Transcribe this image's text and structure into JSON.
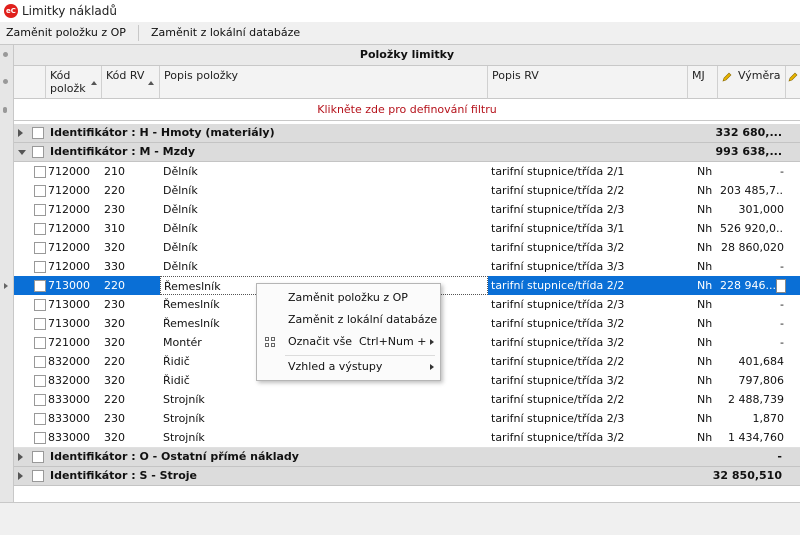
{
  "window": {
    "title": "Limitky nákladů",
    "app_icon_text": "eC"
  },
  "toolbar": {
    "replace_op": "Zaměnit položku z OP",
    "replace_local": "Zaměnit z lokální databáze"
  },
  "grid": {
    "band_title": "Položky limitky",
    "columns": {
      "kod_polozky": "Kód\npoložk",
      "kod_rv": "Kód RV",
      "popis_polozky": "Popis položky",
      "popis_rv": "Popis RV",
      "mj": "MJ",
      "vymera": "Výměra"
    },
    "filter_text": "Klikněte zde pro definování filtru",
    "groups": [
      {
        "label": "Identifikátor : H - Hmoty (materiály)",
        "value": "332 680,..."
      },
      {
        "label": "Identifikátor : M - Mzdy",
        "value": "993 638,..."
      },
      {
        "label": "Identifikátor : O - Ostatní přímé náklady",
        "value": "-"
      },
      {
        "label": "Identifikátor : S - Stroje",
        "value": "32 850,510"
      }
    ],
    "rows": [
      {
        "kod": "712000",
        "rv": "210",
        "popis": "Dělník",
        "popis_rv": "tarifní stupnice/třída 2/1",
        "mj": "Nh",
        "vymera": "-"
      },
      {
        "kod": "712000",
        "rv": "220",
        "popis": "Dělník",
        "popis_rv": "tarifní stupnice/třída 2/2",
        "mj": "Nh",
        "vymera": "203 485,7..."
      },
      {
        "kod": "712000",
        "rv": "230",
        "popis": "Dělník",
        "popis_rv": "tarifní stupnice/třída 2/3",
        "mj": "Nh",
        "vymera": "301,000"
      },
      {
        "kod": "712000",
        "rv": "310",
        "popis": "Dělník",
        "popis_rv": "tarifní stupnice/třída 3/1",
        "mj": "Nh",
        "vymera": "526 920,0..."
      },
      {
        "kod": "712000",
        "rv": "320",
        "popis": "Dělník",
        "popis_rv": "tarifní stupnice/třída 3/2",
        "mj": "Nh",
        "vymera": "28 860,020"
      },
      {
        "kod": "712000",
        "rv": "330",
        "popis": "Dělník",
        "popis_rv": "tarifní stupnice/třída 3/3",
        "mj": "Nh",
        "vymera": "-"
      },
      {
        "kod": "713000",
        "rv": "220",
        "popis": "Řemeslník",
        "popis_rv": "tarifní stupnice/třída 2/2",
        "mj": "Nh",
        "vymera": "228 946...."
      },
      {
        "kod": "713000",
        "rv": "230",
        "popis": "Řemeslník",
        "popis_rv": "tarifní stupnice/třída 2/3",
        "mj": "Nh",
        "vymera": "-"
      },
      {
        "kod": "713000",
        "rv": "320",
        "popis": "Řemeslník",
        "popis_rv": "tarifní stupnice/třída 3/2",
        "mj": "Nh",
        "vymera": "-"
      },
      {
        "kod": "721000",
        "rv": "320",
        "popis": "Montér",
        "popis_rv": "tarifní stupnice/třída 3/2",
        "mj": "Nh",
        "vymera": "-"
      },
      {
        "kod": "832000",
        "rv": "220",
        "popis": "Řidič",
        "popis_rv": "tarifní stupnice/třída 2/2",
        "mj": "Nh",
        "vymera": "401,684"
      },
      {
        "kod": "832000",
        "rv": "320",
        "popis": "Řidič",
        "popis_rv": "tarifní stupnice/třída 3/2",
        "mj": "Nh",
        "vymera": "797,806"
      },
      {
        "kod": "833000",
        "rv": "220",
        "popis": "Strojník",
        "popis_rv": "tarifní stupnice/třída 2/2",
        "mj": "Nh",
        "vymera": "2 488,739"
      },
      {
        "kod": "833000",
        "rv": "230",
        "popis": "Strojník",
        "popis_rv": "tarifní stupnice/třída 2/3",
        "mj": "Nh",
        "vymera": "1,870"
      },
      {
        "kod": "833000",
        "rv": "320",
        "popis": "Strojník",
        "popis_rv": "tarifní stupnice/třída 3/2",
        "mj": "Nh",
        "vymera": "1 434,760"
      }
    ]
  },
  "context_menu": {
    "replace_op": "Zaměnit položku z OP",
    "replace_local": "Zaměnit z lokální databáze",
    "select_all": "Označit vše",
    "select_all_shortcut": "Ctrl+Num +",
    "view_outputs": "Vzhled a výstupy"
  },
  "colors": {
    "selection": "#0a6fd6",
    "filter_text": "#b5121b",
    "group_bg": "#dcdcdc",
    "app_icon": "#e0201c"
  }
}
